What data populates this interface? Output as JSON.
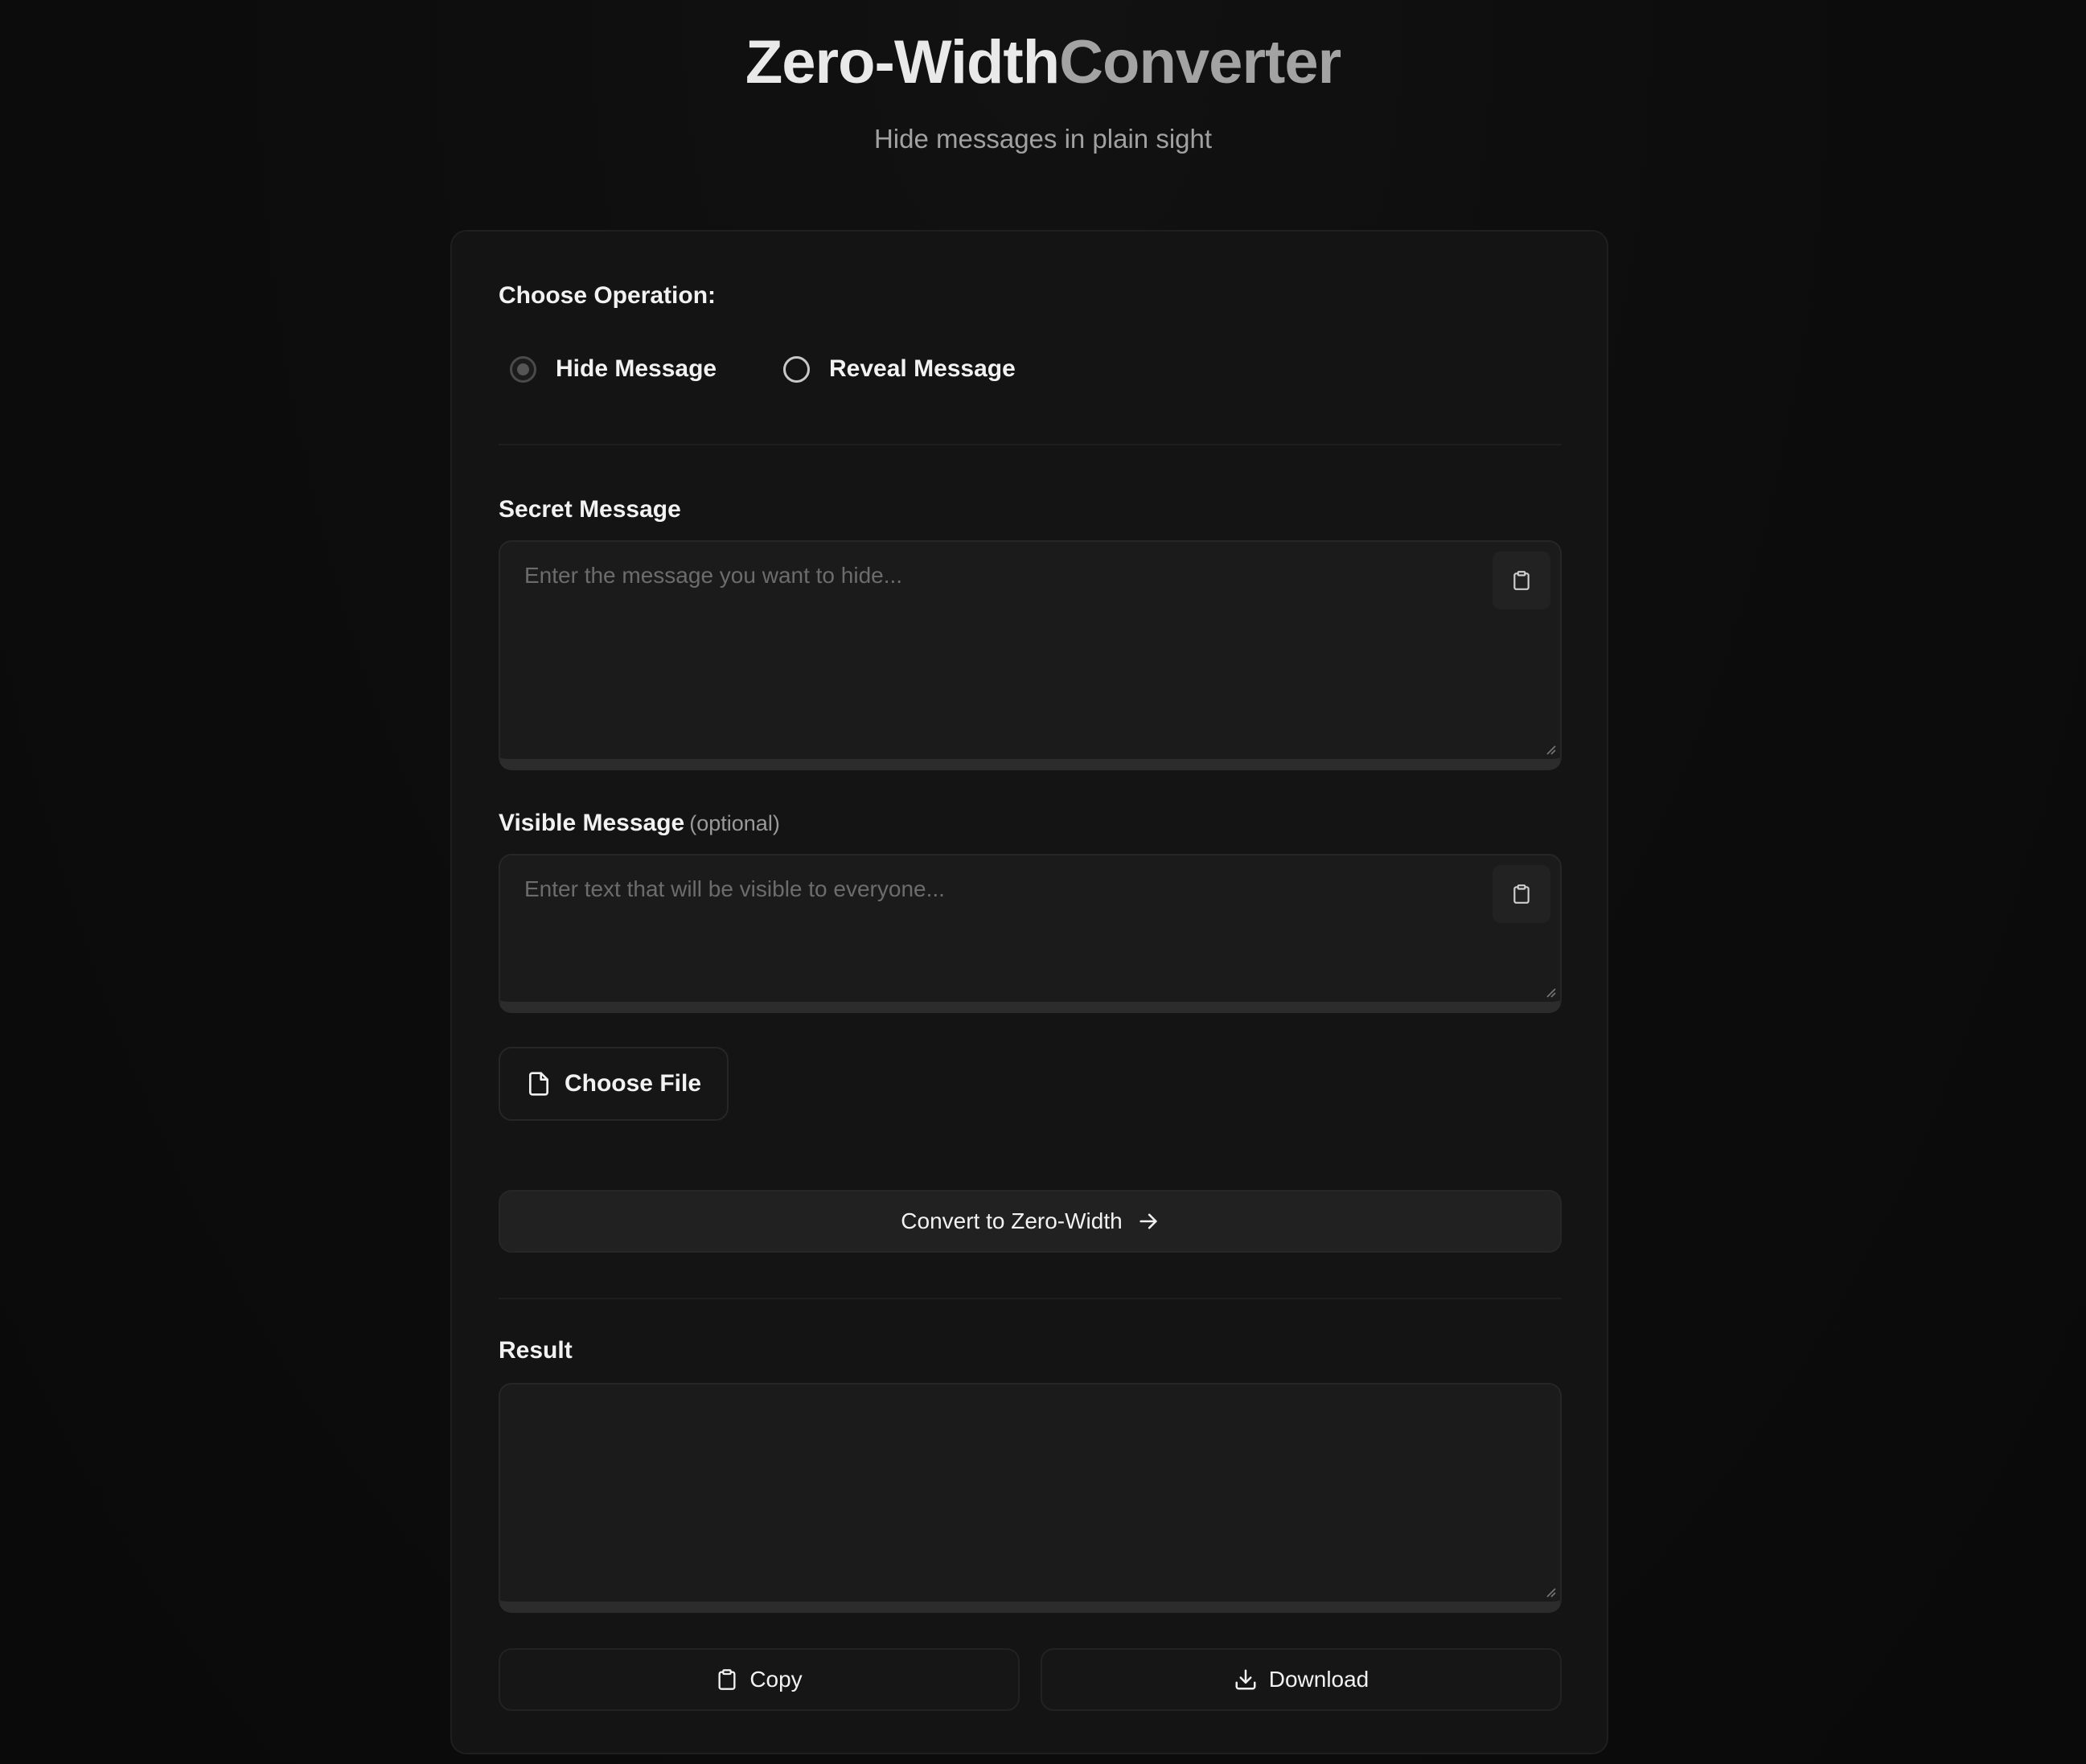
{
  "header": {
    "title_part1": "Zero-Width",
    "title_part2": "Converter",
    "subtitle": "Hide messages in plain sight"
  },
  "operation": {
    "label": "Choose Operation:",
    "options": [
      {
        "label": "Hide Message",
        "selected": true
      },
      {
        "label": "Reveal Message",
        "selected": false
      }
    ]
  },
  "secret_message": {
    "label": "Secret Message",
    "placeholder": "Enter the message you want to hide...",
    "value": "",
    "paste_icon": "clipboard-icon"
  },
  "visible_message": {
    "label": "Visible Message",
    "optional_note": "(optional)",
    "placeholder": "Enter text that will be visible to everyone...",
    "value": "",
    "paste_icon": "clipboard-icon"
  },
  "file": {
    "button_label": "Choose File",
    "icon": "file-icon"
  },
  "convert": {
    "button_label": "Convert to Zero-Width",
    "icon": "arrow-right-icon"
  },
  "result": {
    "label": "Result",
    "value": ""
  },
  "actions": {
    "copy_label": "Copy",
    "copy_icon": "clipboard-icon",
    "download_label": "Download",
    "download_icon": "download-icon"
  },
  "colors": {
    "background": "#0d0d0d",
    "card": "#141414",
    "field": "#1b1b1b",
    "text": "#f2f2f2",
    "muted": "#6c6c6c"
  }
}
